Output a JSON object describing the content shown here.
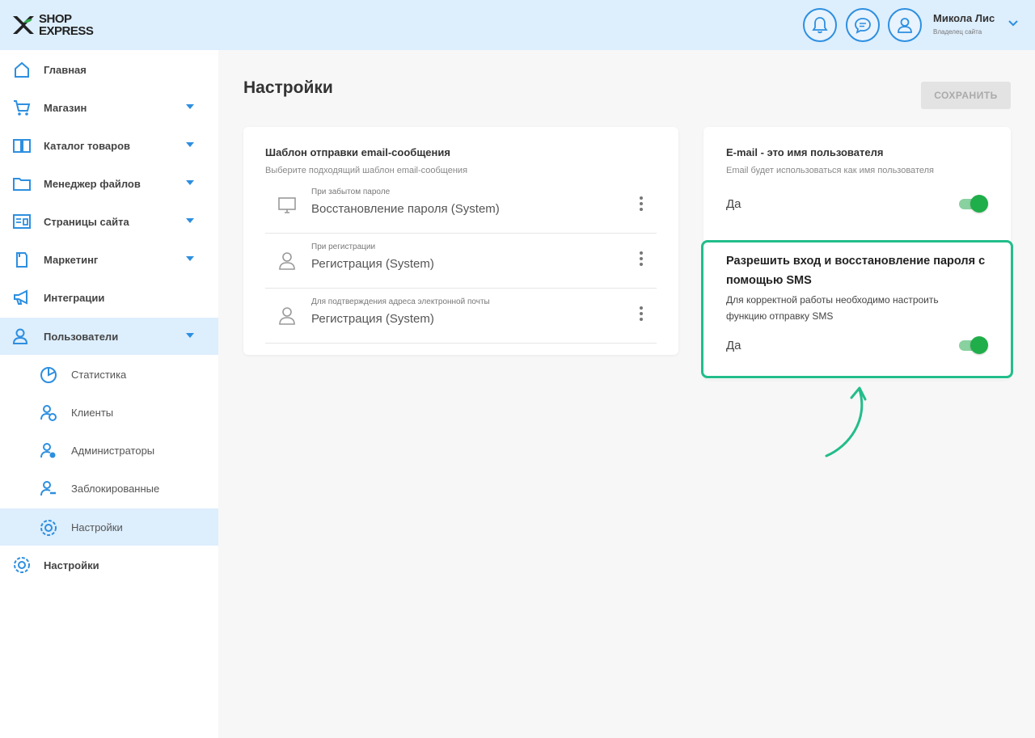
{
  "header": {
    "logo": {
      "line1": "SHOP",
      "line2": "EXPRESS"
    },
    "user": {
      "name": "Микола Лис",
      "role": "Владелец сайта"
    }
  },
  "sidebar": {
    "items": [
      {
        "label": "Главная",
        "icon": "home-icon"
      },
      {
        "label": "Магазин",
        "icon": "cart-icon"
      },
      {
        "label": "Каталог товаров",
        "icon": "catalog-icon"
      },
      {
        "label": "Менеджер файлов",
        "icon": "folder-icon"
      },
      {
        "label": "Страницы сайта",
        "icon": "pages-icon"
      },
      {
        "label": "Маркетинг",
        "icon": "marketing-icon"
      },
      {
        "label": "Интеграции",
        "icon": "megaphone-icon"
      },
      {
        "label": "Пользователи",
        "icon": "users-icon"
      },
      {
        "label": "Настройки",
        "icon": "gear-icon"
      }
    ],
    "sub_items": [
      {
        "label": "Статистика",
        "icon": "chart-icon"
      },
      {
        "label": "Клиенты",
        "icon": "clients-icon"
      },
      {
        "label": "Администраторы",
        "icon": "admins-icon"
      },
      {
        "label": "Заблокированные",
        "icon": "blocked-icon"
      },
      {
        "label": "Настройки",
        "icon": "gear-icon"
      }
    ]
  },
  "main": {
    "title": "Настройки",
    "save_label": "СОХРАНИТЬ",
    "email_card": {
      "title": "Шаблон отправки email-сообщения",
      "subtitle": "Выберите подходящий шаблон email-сообщения",
      "templates": [
        {
          "label": "При забытом пароле",
          "value": "Восстановление пароля (System)",
          "icon": "monitor-icon"
        },
        {
          "label": "При регистрации",
          "value": "Регистрация (System)",
          "icon": "person-icon"
        },
        {
          "label": "Для подтверждения адреса электронной почты",
          "value": "Регистрация (System)",
          "icon": "person-icon"
        }
      ]
    },
    "username_setting": {
      "title": "E-mail - это имя пользователя",
      "subtitle": "Email будет использоваться как имя пользователя",
      "toggle_label": "Да",
      "enabled": true
    },
    "sms_setting": {
      "title": "Разрешить вход и восстановление пароля с помощью SMS",
      "description": "Для корректной работы необходимо настроить функцию отправку SMS",
      "toggle_label": "Да",
      "enabled": true
    }
  },
  "colors": {
    "header_bg": "#ddeefd",
    "accent_blue": "#2d8fe0",
    "toggle_green": "#1fae49",
    "highlight_border": "#22bd8a"
  }
}
